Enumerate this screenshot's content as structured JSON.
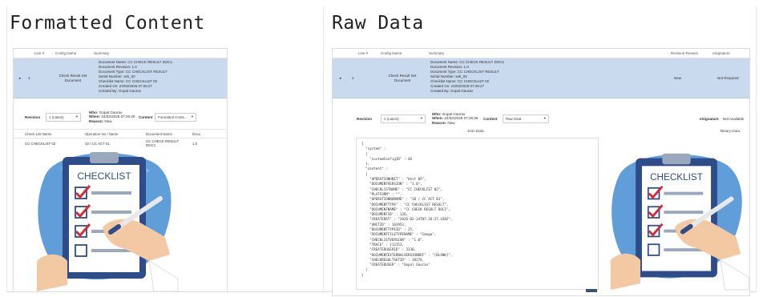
{
  "headings": {
    "formatted": "Formatted Content",
    "raw": "Raw Data"
  },
  "grid": {
    "columns_left": [
      "Line #",
      "Config Name",
      "Summary"
    ],
    "columns_right": [
      "Line #",
      "Config Name",
      "Summary",
      "Revision Reason",
      "eSignature"
    ],
    "row": {
      "expander": "▸",
      "line": "1",
      "config": "Check Result Set Document",
      "summary_lines": [
        "Document Name: CC CHECK RESULT DOC1",
        "Document Revision: 1.0",
        "Document Type: CC CHECKLIST RESULT",
        "Serial Number: sek_02",
        "Checklist Name: CC CHECKLIST 02",
        "Created On: 24/02/2026 07:26:27",
        "Created By: Gopal Gaurav"
      ],
      "revision_reason": "New",
      "esignature": "Not Required"
    }
  },
  "controls": {
    "revision_label": "Revision",
    "revision_value": "1 (Latest)",
    "who_label": "Who:",
    "who_value": "Gopal Gaurav",
    "when_label": "When:",
    "when_value": "24/02/2026 07:26:26",
    "reason_label": "Reason:",
    "reason_value": "New",
    "content_label": "Content",
    "content_value_left": "Formatted Conte...",
    "content_value_right": "Raw Data",
    "esig_label": "eSignature",
    "esig_value": "Not Available"
  },
  "subtable": {
    "headers": [
      "Check List Name",
      "Operation No / Name",
      "Document Name",
      "Docu"
    ],
    "row": [
      "CC CHECKLIST 02",
      "10 / CC ACT 01",
      "CC CHECK RESULT DOC1",
      "1.0"
    ]
  },
  "raw": {
    "json_title": "Json Data",
    "binary_title": "Binary Data"
  },
  "json_text": "{\n  \"system\" :\n  {\n    \"customConfigID\" : 46\n  },\n  \"content\" :\n  {\n    \"OPERATIONUNIT\" : \"Unit 05\",\n    \"DOCUMENTVERSION\" : \"1.0\",\n    \"CHECKLISTNAME\" : \"CC CHECKLIST 02\",\n    \"PLATFORM\" : \"\",\n    \"OPERATIONNONAME\" : \"10 / CC ACT 01\",\n    \"DOCUMENTTYPE\" : \"CC CHECKLIST RESULT\",\n    \"DOCUMENTNAME\" : \"CC CHECK RESULT DOC1\",\n    \"DOCUMENTID\" : 126,\n    \"CREATEDAT\" : \"2026-02-24T07:26:27.430Z\",\n    \"UNITID\" : 163953,\n    \"DOCUMENTTYPEID\" : 25,\n    \"DOCUMENTFILETYPENAME\" : \"Image\",\n    \"CHECKLISTVERSION\" : \"1.0\",\n    \"TRACE\" : 112153,\n    \"CREATEDUSERID\" : 3130,\n    \"DOCUMENTEXTERNALVERSIONREF\" : \"[BLANK]\",\n    \"CHECKRESULTSETID\" : 38276,\n    \"CREATEDUSER\" : \"Gopal Gaurav\"\n  }\n}",
  "illustration": {
    "title": "CHECKLIST",
    "checkbox_states": [
      true,
      true,
      true,
      false
    ]
  },
  "colors": {
    "selected_row": "#c9d9ee",
    "blob": "#4f93d6",
    "clipboard": "#2e4c8a"
  }
}
